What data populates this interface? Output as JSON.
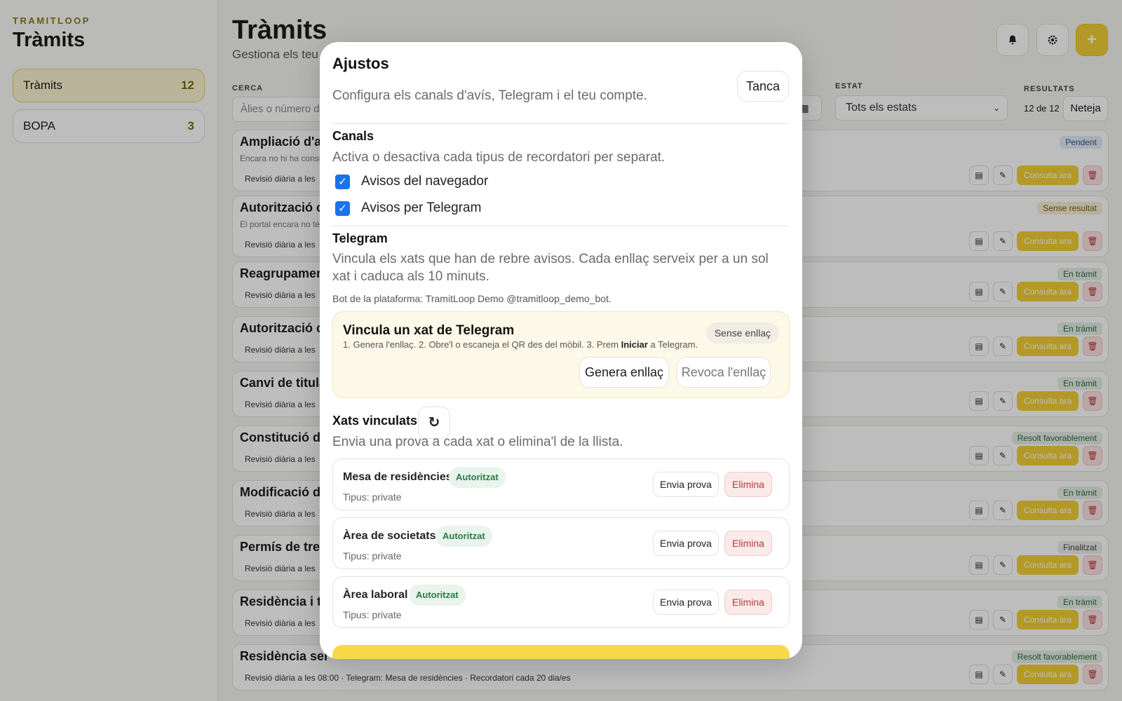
{
  "app": {
    "brand": "TRAMITLOOP",
    "title": "Tràmits"
  },
  "sidebar": {
    "items": [
      {
        "label": "Tràmits",
        "count": "12"
      },
      {
        "label": "BOPA",
        "count": "3"
      }
    ]
  },
  "header": {
    "title": "Tràmits",
    "subtitle": "Gestiona els teu",
    "bell_icon": "bell-icon",
    "settings_icon": "gear-icon",
    "add_label": "+"
  },
  "filters": {
    "search_label": "CERCA",
    "search_placeholder": "Àlies o número de",
    "date_icon": "calendar-icon",
    "estat_label": "ESTAT",
    "estat_value": "Tots els estats",
    "results_label": "RESULTATS",
    "results_count": "12 de 12",
    "clear_label": "Neteja"
  },
  "rows": [
    {
      "title": "Ampliació d'a",
      "desc": "Encara no hi ha consu",
      "sched": "Revisió diària a les",
      "badge": "Pendent"
    },
    {
      "title": "Autorització c",
      "desc": "El portal encara no té",
      "sched": "Revisió diària a les",
      "badge": "Sense resultat"
    },
    {
      "title": "Reagrupamen",
      "sched": "Revisió diària a les",
      "badge": "En tràmit"
    },
    {
      "title": "Autorització c",
      "sched": "Revisió diària a les",
      "badge": "En tràmit"
    },
    {
      "title": "Canvi de titula",
      "sched": "Revisió diària a les",
      "badge": "En tràmit"
    },
    {
      "title": "Constitució d",
      "sched": "Revisió diària a les",
      "badge": "Resolt favorablement"
    },
    {
      "title": "Modificació d",
      "sched": "Revisió diària a les",
      "badge": "En tràmit"
    },
    {
      "title": "Permís de trel",
      "sched": "Revisió diària a les",
      "badge": "Finalitzat"
    },
    {
      "title": "Residència i tr",
      "sched": "Revisió diària a les",
      "badge": "En tràmit"
    },
    {
      "title": "Residència sei",
      "sched": "Revisió diària a les 08:00 · Telegram: Mesa de residències · Recordatori cada 20 dia/es",
      "badge": "Resolt favorablement"
    }
  ],
  "row_actions": {
    "consulta_label": "Consulta ara",
    "doc_icon": "document-icon",
    "edit_icon": "pencil-icon",
    "delete_icon": "trash-icon"
  },
  "modal": {
    "title": "Ajustos",
    "close_label": "Tanca",
    "subtitle": "Configura els canals d'avís, Telegram i el teu compte.",
    "canals": {
      "title": "Canals",
      "desc": "Activa o desactiva cada tipus de recordatori per separat.",
      "browser_label": "Avisos del navegador",
      "telegram_label": "Avisos per Telegram"
    },
    "telegram": {
      "title": "Telegram",
      "desc": "Vincula els xats que han de rebre avisos. Cada enllaç serveix per a un sol xat i caduca als 10 minuts.",
      "bot": "Bot de la plataforma: TramitLoop Demo @tramitloop_demo_bot."
    },
    "link_card": {
      "title": "Vincula un xat de Telegram",
      "steps_before": "1. Genera l'enllaç. 2. Obre'l o escaneja el QR des del mòbil. 3. Prem",
      "steps_bold": "Iniciar",
      "steps_after": "a Telegram.",
      "status": "Sense enllaç",
      "generate_label": "Genera enllaç",
      "revoke_label": "Revoca l'enllaç"
    },
    "chats": {
      "title": "Xats vinculats",
      "refresh_icon": "refresh-icon",
      "desc": "Envia una prova a cada xat o elimina'l de la llista.",
      "items": [
        {
          "name": "Mesa de residències",
          "status": "Autoritzat",
          "type": "Tipus: private"
        },
        {
          "name": "Àrea de societats",
          "status": "Autoritzat",
          "type": "Tipus: private"
        },
        {
          "name": "Àrea laboral",
          "status": "Autoritzat",
          "type": "Tipus: private"
        }
      ],
      "test_label": "Envia prova",
      "delete_label": "Elimina"
    }
  },
  "colors": {
    "accent": "#f2cf36",
    "checkbox": "#1a73e8",
    "authorized": "#2b7a44",
    "danger": "#b23b3b"
  }
}
